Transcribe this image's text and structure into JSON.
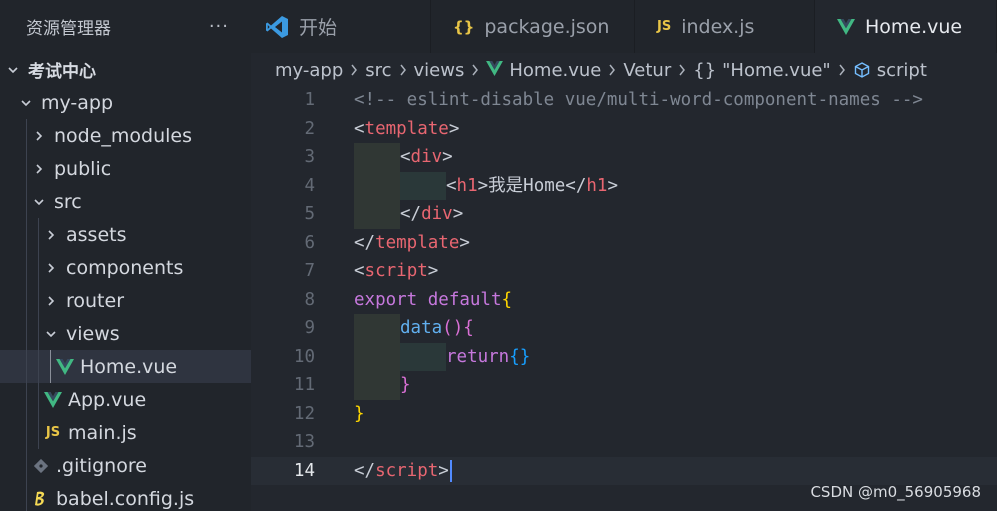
{
  "sidebar": {
    "title": "资源管理器",
    "more": "···",
    "section": "考试中心",
    "items": [
      {
        "label": "my-app"
      },
      {
        "label": "node_modules"
      },
      {
        "label": "public"
      },
      {
        "label": "src"
      },
      {
        "label": "assets"
      },
      {
        "label": "components"
      },
      {
        "label": "router"
      },
      {
        "label": "views"
      },
      {
        "label": "Home.vue"
      },
      {
        "label": "App.vue"
      },
      {
        "label": "main.js"
      },
      {
        "label": ".gitignore"
      },
      {
        "label": "babel.config.js"
      }
    ],
    "icons": {
      "js": "JS"
    }
  },
  "tabs": [
    {
      "label": "开始",
      "icon": "vscode-icon"
    },
    {
      "label": "package.json",
      "icon": "json-braces-icon"
    },
    {
      "label": "index.js",
      "icon": "js-icon"
    },
    {
      "label": "Home.vue",
      "icon": "vue-icon",
      "modified": true
    }
  ],
  "breadcrumb": [
    "my-app",
    "src",
    "views",
    "Home.vue",
    "Vetur",
    "\"Home.vue\"",
    "script"
  ],
  "breadcrumb_icons": {
    "braces": "{}"
  },
  "editor": {
    "line_numbers": [
      "1",
      "2",
      "3",
      "4",
      "5",
      "6",
      "7",
      "8",
      "9",
      "10",
      "11",
      "12",
      "13",
      "14"
    ],
    "current_line": 14,
    "lines": {
      "l1": "<!-- eslint-disable vue/multi-word-component-names -->",
      "l2_open": "<",
      "l2_tag": "template",
      "l2_close": ">",
      "l3_open": "<",
      "l3_tag": "div",
      "l3_close": ">",
      "l4_open": "<",
      "l4_tag": "h1",
      "l4_mid": ">我是Home</",
      "l4_tag2": "h1",
      "l4_close": ">",
      "l5_open": "</",
      "l5_tag": "div",
      "l5_close": ">",
      "l6_open": "</",
      "l6_tag": "template",
      "l6_close": ">",
      "l7_open": "<",
      "l7_tag": "script",
      "l7_close": ">",
      "l8_kw": "export default",
      "l8_br": "{",
      "l9_fn": "data",
      "l9_br": "(){",
      "l10_kw": "return",
      "l10_br": "{}",
      "l11_br": "}",
      "l12_br": "}",
      "l14_open": "</",
      "l14_tag": "script",
      "l14_close": ">"
    }
  },
  "watermark": "CSDN @m0_56905968",
  "colors": {
    "vue_green": "#41b883",
    "vscode_blue": "#3b9ae1",
    "json_yellow": "#e8c547",
    "tag_red": "#e86671",
    "keyword_purple": "#c678dd",
    "function_blue": "#61afef"
  }
}
